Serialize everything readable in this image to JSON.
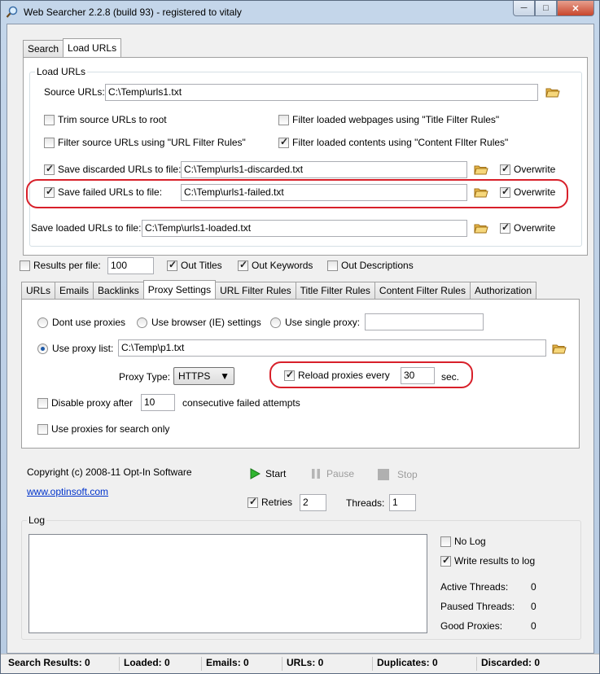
{
  "window": {
    "title": "Web Searcher 2.2.8 (build 93) - registered to vitaly",
    "min": "─",
    "max": "□",
    "close": "✕"
  },
  "main_tabs": [
    "Search",
    "Load URLs"
  ],
  "load_urls": {
    "group_label": "Load URLs",
    "source_label": "Source URLs:",
    "source_value": "C:\\Temp\\urls1.txt",
    "trim_label": "Trim source URLs to root",
    "trim_checked": false,
    "filter_title_label": "Filter loaded webpages using \"Title Filter Rules\"",
    "filter_title_checked": false,
    "filter_url_label": "Filter source URLs using \"URL Filter Rules\"",
    "filter_url_checked": false,
    "filter_content_label": "Filter loaded contents using \"Content FIlter Rules\"",
    "filter_content_checked": true,
    "save_discarded_label": "Save discarded URLs to file:",
    "save_discarded_checked": true,
    "discarded_value": "C:\\Temp\\urls1-discarded.txt",
    "overwrite_label": "Overwrite",
    "save_failed_label": "Save failed URLs to file:",
    "save_failed_checked": true,
    "failed_value": "C:\\Temp\\urls1-failed.txt",
    "save_loaded_label": "Save loaded URLs to file:",
    "loaded_value": "C:\\Temp\\urls1-loaded.txt"
  },
  "options": {
    "results_per_file_label": "Results per file:",
    "results_per_file_value": "100",
    "out_titles": "Out Titles",
    "out_keywords": "Out Keywords",
    "out_descriptions": "Out Descriptions"
  },
  "sub_tabs": [
    "URLs",
    "Emails",
    "Backlinks",
    "Proxy Settings",
    "URL Filter Rules",
    "Title Filter Rules",
    "Content Filter Rules",
    "Authorization"
  ],
  "proxy": {
    "dont_use": "Dont use proxies",
    "browser": "Use browser (IE) settings",
    "single": "Use single proxy:",
    "single_value": "",
    "list": "Use proxy list:",
    "list_value": "C:\\Temp\\p1.txt",
    "type_label": "Proxy Type:",
    "type_value": "HTTPS",
    "reload_label": "Reload proxies every",
    "reload_value": "30",
    "reload_unit": "sec.",
    "disable_label": "Disable proxy after",
    "disable_value": "10",
    "disable_suffix": "consecutive failed attempts",
    "search_only": "Use proxies for search only"
  },
  "footer": {
    "copyright": "Copyright (c) 2008-11 Opt-In Software",
    "link": "www.optinsoft.com",
    "start": "Start",
    "pause": "Pause",
    "stop": "Stop",
    "retries_label": "Retries",
    "retries_value": "2",
    "threads_label": "Threads:",
    "threads_value": "1"
  },
  "log": {
    "label": "Log",
    "no_log": "No Log",
    "write_results": "Write results to log",
    "active_threads_label": "Active Threads:",
    "active_threads_value": "0",
    "paused_threads_label": "Paused Threads:",
    "paused_threads_value": "0",
    "good_proxies_label": "Good Proxies:",
    "good_proxies_value": "0"
  },
  "status": {
    "search_results": "Search Results: 0",
    "loaded": "Loaded: 0",
    "emails": "Emails: 0",
    "urls": "URLs: 0",
    "duplicates": "Duplicates: 0",
    "discarded": "Discarded: 0"
  }
}
